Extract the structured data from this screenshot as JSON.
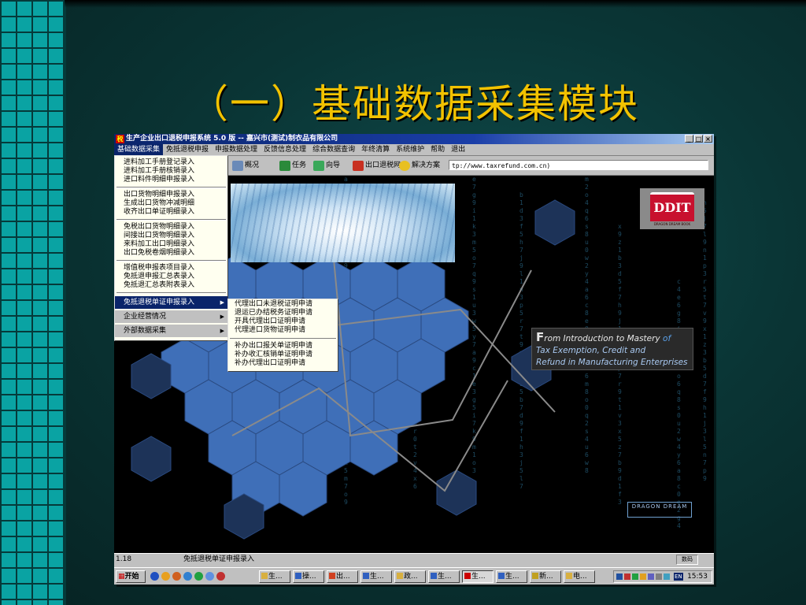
{
  "slide": {
    "title": "（一）基础数据采集模块"
  },
  "window": {
    "title": "生产企业出口退税申报系统 5.0 版 -- 嘉兴市(测试)制衣品有限公司",
    "controls": [
      "_",
      "□",
      "×"
    ]
  },
  "menubar": {
    "items": [
      "基础数据采集",
      "免抵退税申报",
      "申报数据处理",
      "反馈信息处理",
      "综合数据查询",
      "年终清算",
      "系统维护",
      "帮助",
      "退出"
    ],
    "active": "基础数据采集"
  },
  "toolbar": {
    "buttons": [
      "概况",
      "任务",
      "向导",
      "出口退税网",
      "解决方案"
    ],
    "address": "tp://www.taxrefund.com.cn)"
  },
  "menu_primary": {
    "group1": [
      "进料加工手册登记录入",
      "进料加工手册核销录入",
      "进口料件明细申报录入"
    ],
    "group2": [
      "出口货物明细申报录入",
      "生成出口货物冲减明细",
      "收齐出口单证明细录入"
    ],
    "group3": [
      "免税出口货物明细录入",
      "间接出口货物明细录入",
      "来料加工出口明细录入",
      "出口免税卷烟明细录入"
    ],
    "group4": [
      "增值税申报表项目录入",
      "免抵退申报汇总表录入",
      "免抵退汇总表附表录入"
    ],
    "submenus": [
      "免抵退税单证申报录入",
      "企业经营情况",
      "外部数据采集"
    ],
    "highlighted": "免抵退税单证申报录入"
  },
  "menu_secondary": {
    "group1": [
      "代理出口未退税证明申请",
      "退运已办结税务证明申请",
      "开具代理出口证明申请",
      "代理进口货物证明申请"
    ],
    "group2": [
      "补办出口报关单证明申请",
      "补办收汇核销单证明申请",
      "补办代理出口证明申请"
    ]
  },
  "content": {
    "logo_text": "DDIT",
    "logo_sub": "DRAGON DREAM BOOK",
    "promo_first": "F",
    "promo_line1": "rom Introduction to Mastery",
    "promo_of": "of",
    "promo_line2": "Tax Exemption, Credit and",
    "promo_line3": "Refund in Manufacturing Enterprises",
    "bottom_logo": "DRAGON DREAM"
  },
  "statusbar": {
    "left": "1.18",
    "message": "免抵退税单证申报录入",
    "right": "数码"
  },
  "taskbar": {
    "start": "开始",
    "tasks": [
      "生...",
      "操...",
      "出...",
      "生...",
      "政...",
      "生...",
      "生...",
      "生...",
      "新...",
      "电..."
    ],
    "active_index": 6,
    "lang": "EN",
    "clock": "15:53"
  },
  "colors": {
    "title": "#f2c200",
    "menu_highlight": "#0a246a",
    "hex_blue": "#4a78c0"
  }
}
